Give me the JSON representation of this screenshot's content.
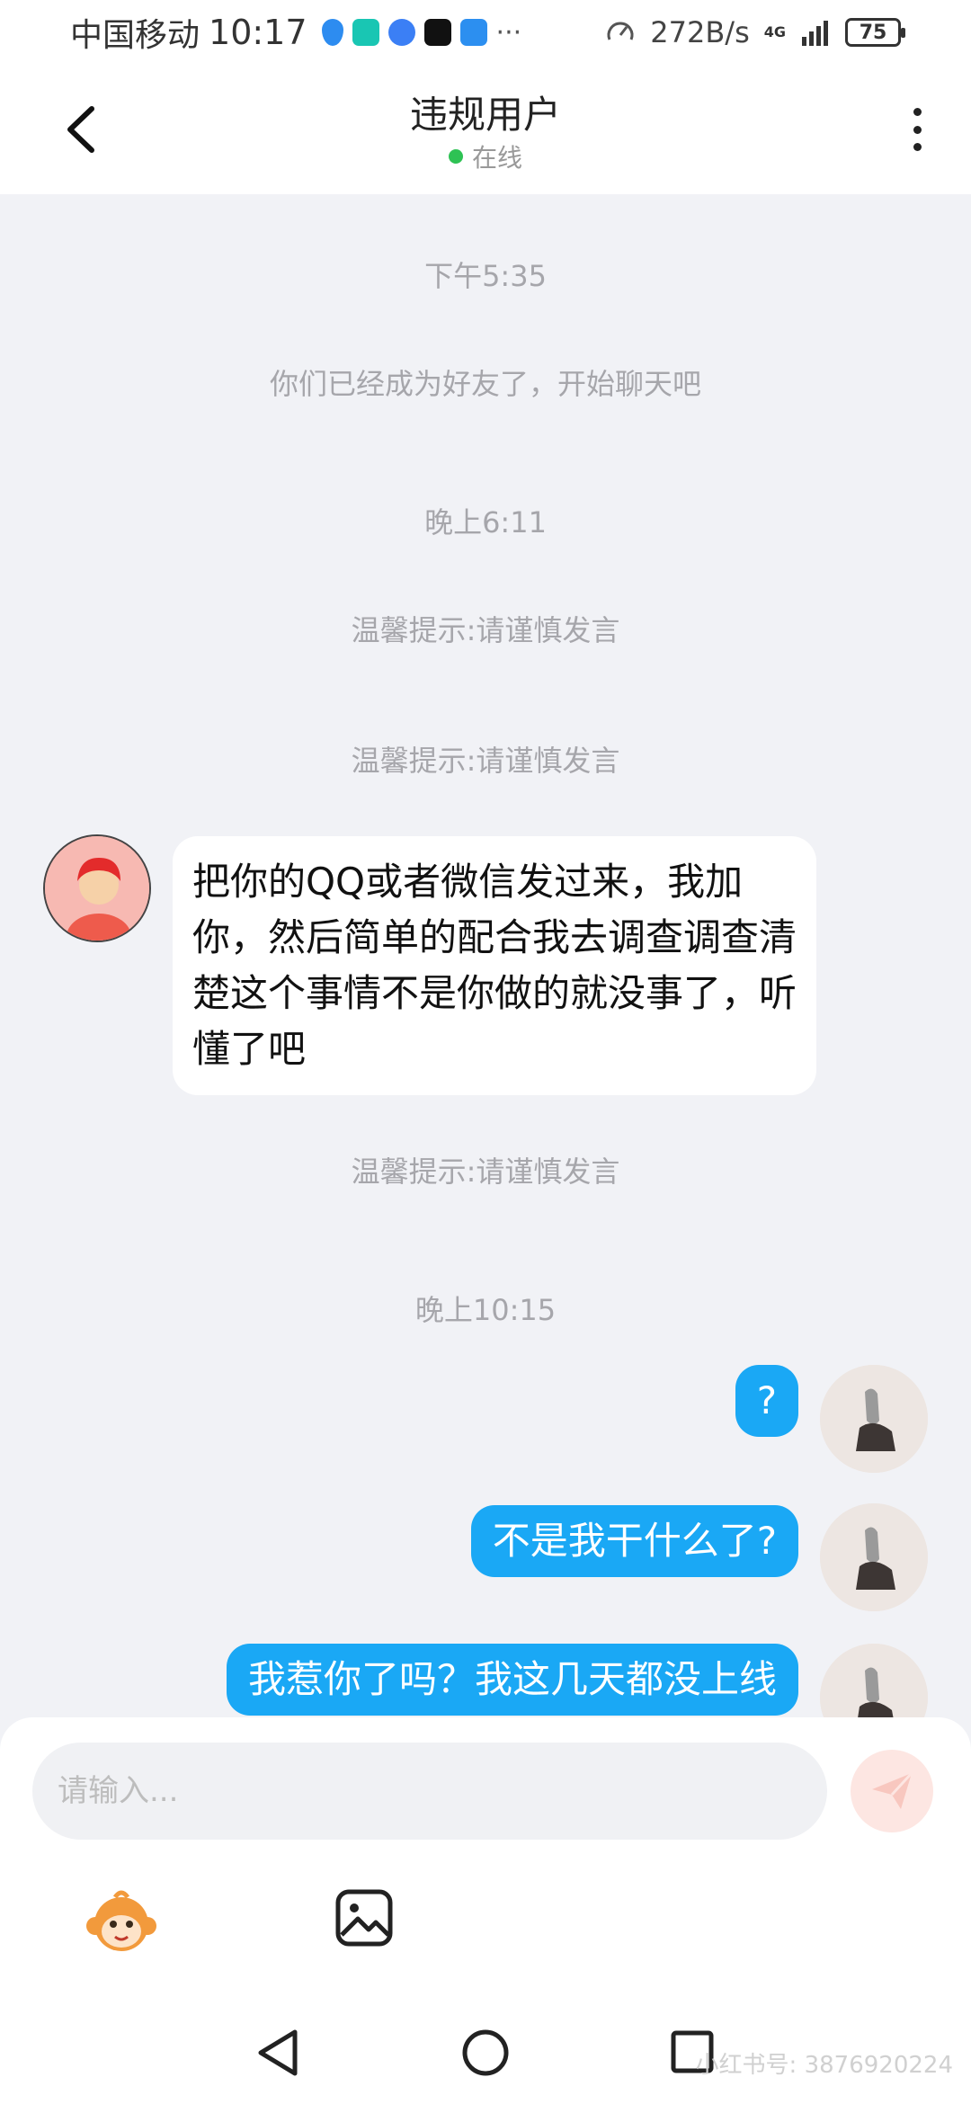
{
  "status_bar": {
    "carrier": "中国移动",
    "time": "10:17",
    "speed": "272B/s",
    "network": "4G",
    "battery": "75"
  },
  "header": {
    "title": "违规用户",
    "status": "在线"
  },
  "messages": {
    "time1": "下午5:35",
    "friend_notice": "你们已经成为好友了，开始聊天吧",
    "time2": "晚上6:11",
    "tip1": "温馨提示:请谨慎发言",
    "tip2": "温馨提示:请谨慎发言",
    "incoming_text": "把你的QQ或者微信发过来，我加你，然后简单的配合我去调查调查清楚这个事情不是你做的就没事了，听懂了吧",
    "tip3": "温馨提示:请谨慎发言",
    "time3": "晚上10:15",
    "outgoing_1": "?",
    "outgoing_2": "不是我干什么了?",
    "outgoing_3": "我惹你了吗？我这几天都没上线"
  },
  "input": {
    "placeholder": "请输入..."
  },
  "watermark": "小红书号: 3876920224",
  "colors": {
    "accent": "#1aa8f5",
    "online": "#2ec254",
    "background": "#f1f2f6"
  }
}
